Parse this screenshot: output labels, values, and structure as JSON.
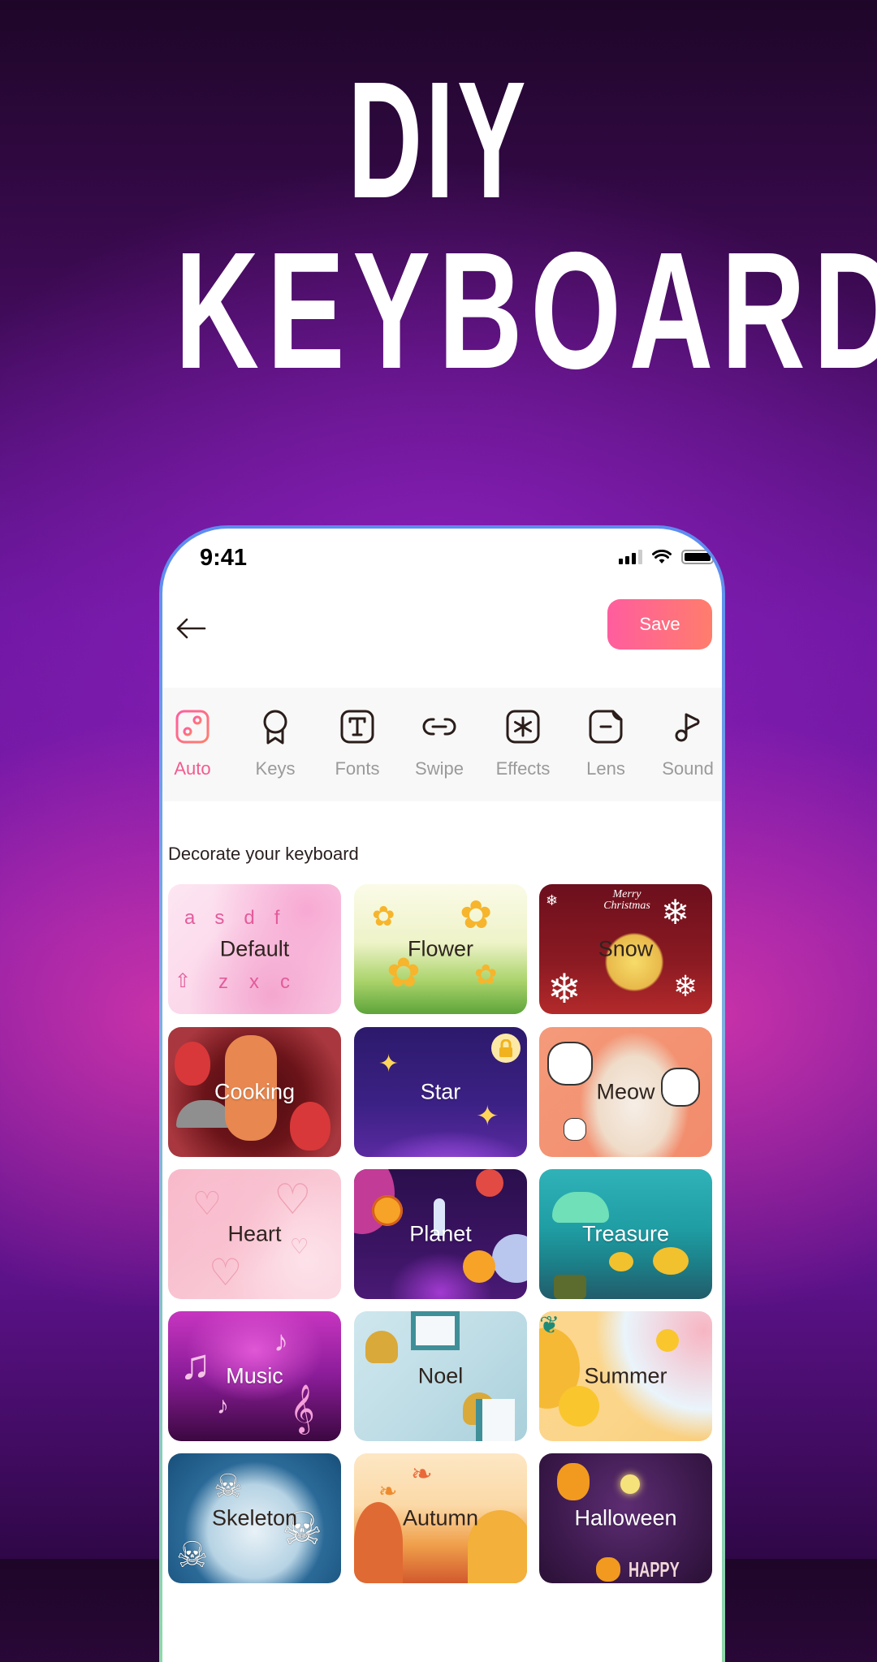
{
  "headline": {
    "line1": "DIY",
    "line2": "KEYBOARDS"
  },
  "status_bar": {
    "time": "9:41",
    "icons": [
      "cellular-signal-icon",
      "wifi-icon",
      "battery-icon"
    ]
  },
  "header": {
    "back_icon": "arrow-left-icon",
    "save_label": "Save"
  },
  "colors": {
    "accent_gradient_start": "#ff5d9e",
    "accent_gradient_end": "#ff7d6c",
    "active_tab": "#f35b8e",
    "inactive_tab": "#9a9a9a",
    "toolbar_bg": "#f8f8f8"
  },
  "toolbar": {
    "active": "Auto",
    "items": [
      {
        "label": "Auto",
        "icon": "sliders-icon"
      },
      {
        "label": "Keys",
        "icon": "badge-icon"
      },
      {
        "label": "Fonts",
        "icon": "text-box-icon"
      },
      {
        "label": "Swipe",
        "icon": "link-icon"
      },
      {
        "label": "Effects",
        "icon": "asterisk-box-icon"
      },
      {
        "label": "Lens",
        "icon": "note-minus-icon"
      },
      {
        "label": "Sound",
        "icon": "music-note-icon"
      }
    ]
  },
  "section": {
    "title": "Decorate your keyboard"
  },
  "themes": [
    {
      "name": "Default",
      "locked": false
    },
    {
      "name": "Flower",
      "locked": false
    },
    {
      "name": "Snow",
      "locked": false
    },
    {
      "name": "Cooking",
      "locked": false
    },
    {
      "name": "Star",
      "locked": true
    },
    {
      "name": "Meow",
      "locked": false
    },
    {
      "name": "Heart",
      "locked": false
    },
    {
      "name": "Planet",
      "locked": false
    },
    {
      "name": "Treasure",
      "locked": false
    },
    {
      "name": "Music",
      "locked": false
    },
    {
      "name": "Noel",
      "locked": false
    },
    {
      "name": "Summer",
      "locked": false
    },
    {
      "name": "Skeleton",
      "locked": false
    },
    {
      "name": "Autumn",
      "locked": false
    },
    {
      "name": "Halloween",
      "locked": false
    }
  ],
  "default_tile_keys": [
    "a",
    "s",
    "d",
    "f",
    "z",
    "x",
    "c"
  ],
  "snow_tile_text": "Merry Christmas",
  "halloween_tile_text": "HAPPY"
}
